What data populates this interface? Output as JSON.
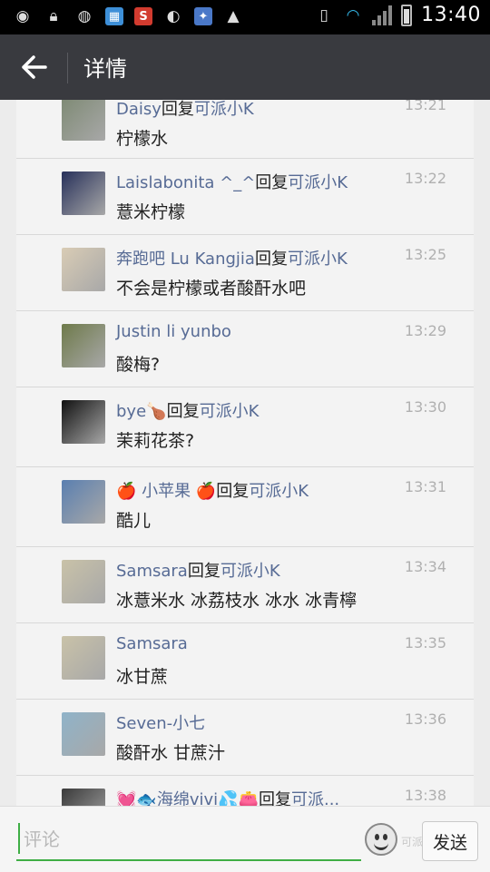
{
  "status_bar": {
    "time": "13:40",
    "icons": [
      "weibo-icon",
      "lock-icon",
      "wechat-icon",
      "app-icon",
      "s-app-icon",
      "chat-bubble-icon",
      "clean-app-icon",
      "warning-icon"
    ]
  },
  "header": {
    "title": "详情"
  },
  "comments": [
    {
      "name": "Daisy",
      "reply_word": "回复",
      "reply_to": "可派小K",
      "time": "13:21",
      "content": "柠檬水",
      "avatar": "#7e8a74"
    },
    {
      "name": "Laislabonita ^_^",
      "reply_word": "回复",
      "reply_to": "可派小K",
      "time": "13:22",
      "content": "薏米柠檬",
      "avatar": "#27305a"
    },
    {
      "name": "奔跑吧 Lu Kangjia",
      "reply_word": "回复",
      "reply_to": "可派小K",
      "time": "13:25",
      "content": "不会是柠檬或者酸酐水吧",
      "avatar": "#d9ccb5"
    },
    {
      "name": "Justin li yunbo",
      "reply_word": "",
      "reply_to": "",
      "time": "13:29",
      "content": "酸梅?",
      "avatar": "#6e7a4a"
    },
    {
      "name": "bye🍗",
      "reply_word": "回复",
      "reply_to": "可派小K",
      "time": "13:30",
      "content": "茉莉花茶?",
      "avatar": "#111111"
    },
    {
      "name": "🍎 小苹果 🍎",
      "reply_word": "回复",
      "reply_to": "可派小K",
      "time": "13:31",
      "content": "酷儿",
      "avatar": "#5a7fb0"
    },
    {
      "name": "Samsara",
      "reply_word": "回复",
      "reply_to": "可派小K",
      "time": "13:34",
      "content": "冰薏米水 冰荔枝水 冰水 冰青檸",
      "avatar": "#c9c2a8"
    },
    {
      "name": "Samsara",
      "reply_word": "",
      "reply_to": "",
      "time": "13:35",
      "content": "冰甘蔗",
      "avatar": "#c9c2a8"
    },
    {
      "name": "Seven-小七",
      "reply_word": "",
      "reply_to": "",
      "time": "13:36",
      "content": "酸酐水 甘蔗汁",
      "avatar": "#8fb3c9"
    },
    {
      "name": "💓🐟海绵vivi💦👛",
      "reply_word": "回复",
      "reply_to": "可派...",
      "time": "13:38",
      "content": "",
      "avatar": "#3a3a3a"
    }
  ],
  "composer": {
    "placeholder": "评论",
    "send_label": "发送",
    "watermark": "可派小K"
  }
}
